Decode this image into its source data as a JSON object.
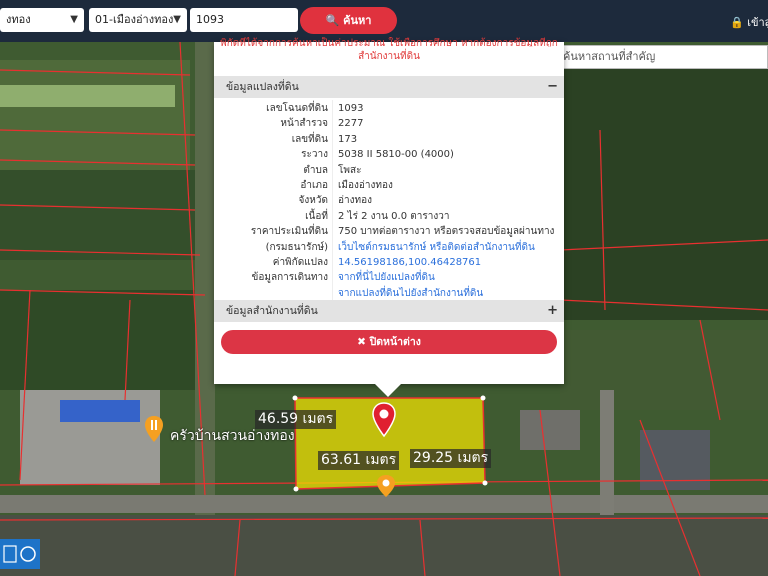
{
  "header": {
    "province_select": "งทอง",
    "district_select": "01-เมืองอ่างทอง",
    "parcel_input": "1093",
    "search_label": "ค้นหา",
    "login_label": "เข้าสู่"
  },
  "map": {
    "place_search_placeholder": "ค้นหาสถานที่สำคัญ",
    "restaurant_label": "ครัวบ้านสวนอ่างทอง",
    "measurements": {
      "top": "46.59 เมตร",
      "bottom": "63.61 เมตร",
      "right": "29.25 เมตร"
    }
  },
  "panel": {
    "notice_line1": "พิกัดที่ได้จากการค้นหาเป็นค่าประมาณ ใช้เพื่อการศึกษา หากต้องการข้อมูลที่ถูกต้อง",
    "notice_line2": "สำนักงานที่ดิน",
    "section1_title": "ข้อมูลแปลงที่ดิน",
    "section1_toggle": "−",
    "section2_title": "ข้อมูลสำนักงานที่ดิน",
    "section2_toggle": "+",
    "close_label": "✖ ปิดหน้าต่าง",
    "rows": [
      {
        "label": "เลขโฉนดที่ดิน",
        "value": "1093"
      },
      {
        "label": "หน้าสำรวจ",
        "value": "2277"
      },
      {
        "label": "เลขที่ดิน",
        "value": "173"
      },
      {
        "label": "ระวาง",
        "value": "5038 II 5810-00 (4000)"
      },
      {
        "label": "ตำบล",
        "value": "โพสะ"
      },
      {
        "label": "อำเภอ",
        "value": "เมืองอ่างทอง"
      },
      {
        "label": "จังหวัด",
        "value": "อ่างทอง"
      },
      {
        "label": "เนื้อที่",
        "value": "2 ไร่ 2 งาน 0.0 ตารางวา"
      },
      {
        "label": "ราคาประเมินที่ดิน",
        "value": "750 บาทต่อตารางวา หรือตรวจสอบข้อมูลผ่านทาง"
      },
      {
        "label": "(กรมธนารักษ์)",
        "value": "เว็บไซต์กรมธนารักษ์ หรือติดต่อสำนักงานที่ดิน"
      },
      {
        "label": "ค่าพิกัดแปลง",
        "value": "14.56198186,100.46428761"
      },
      {
        "label": "ข้อมูลการเดินทาง",
        "value": "จากที่นี่ไปยังแปลงที่ดิน"
      },
      {
        "label": "",
        "value": "จากแปลงที่ดินไปยังสำนักงานที่ดิน"
      }
    ]
  },
  "colors": {
    "topbar": "#1d2a3c",
    "accent_red": "#e0323e",
    "parcel_fill": "#f5e600",
    "boundary": "#e83030",
    "link": "#2a6fdb"
  }
}
